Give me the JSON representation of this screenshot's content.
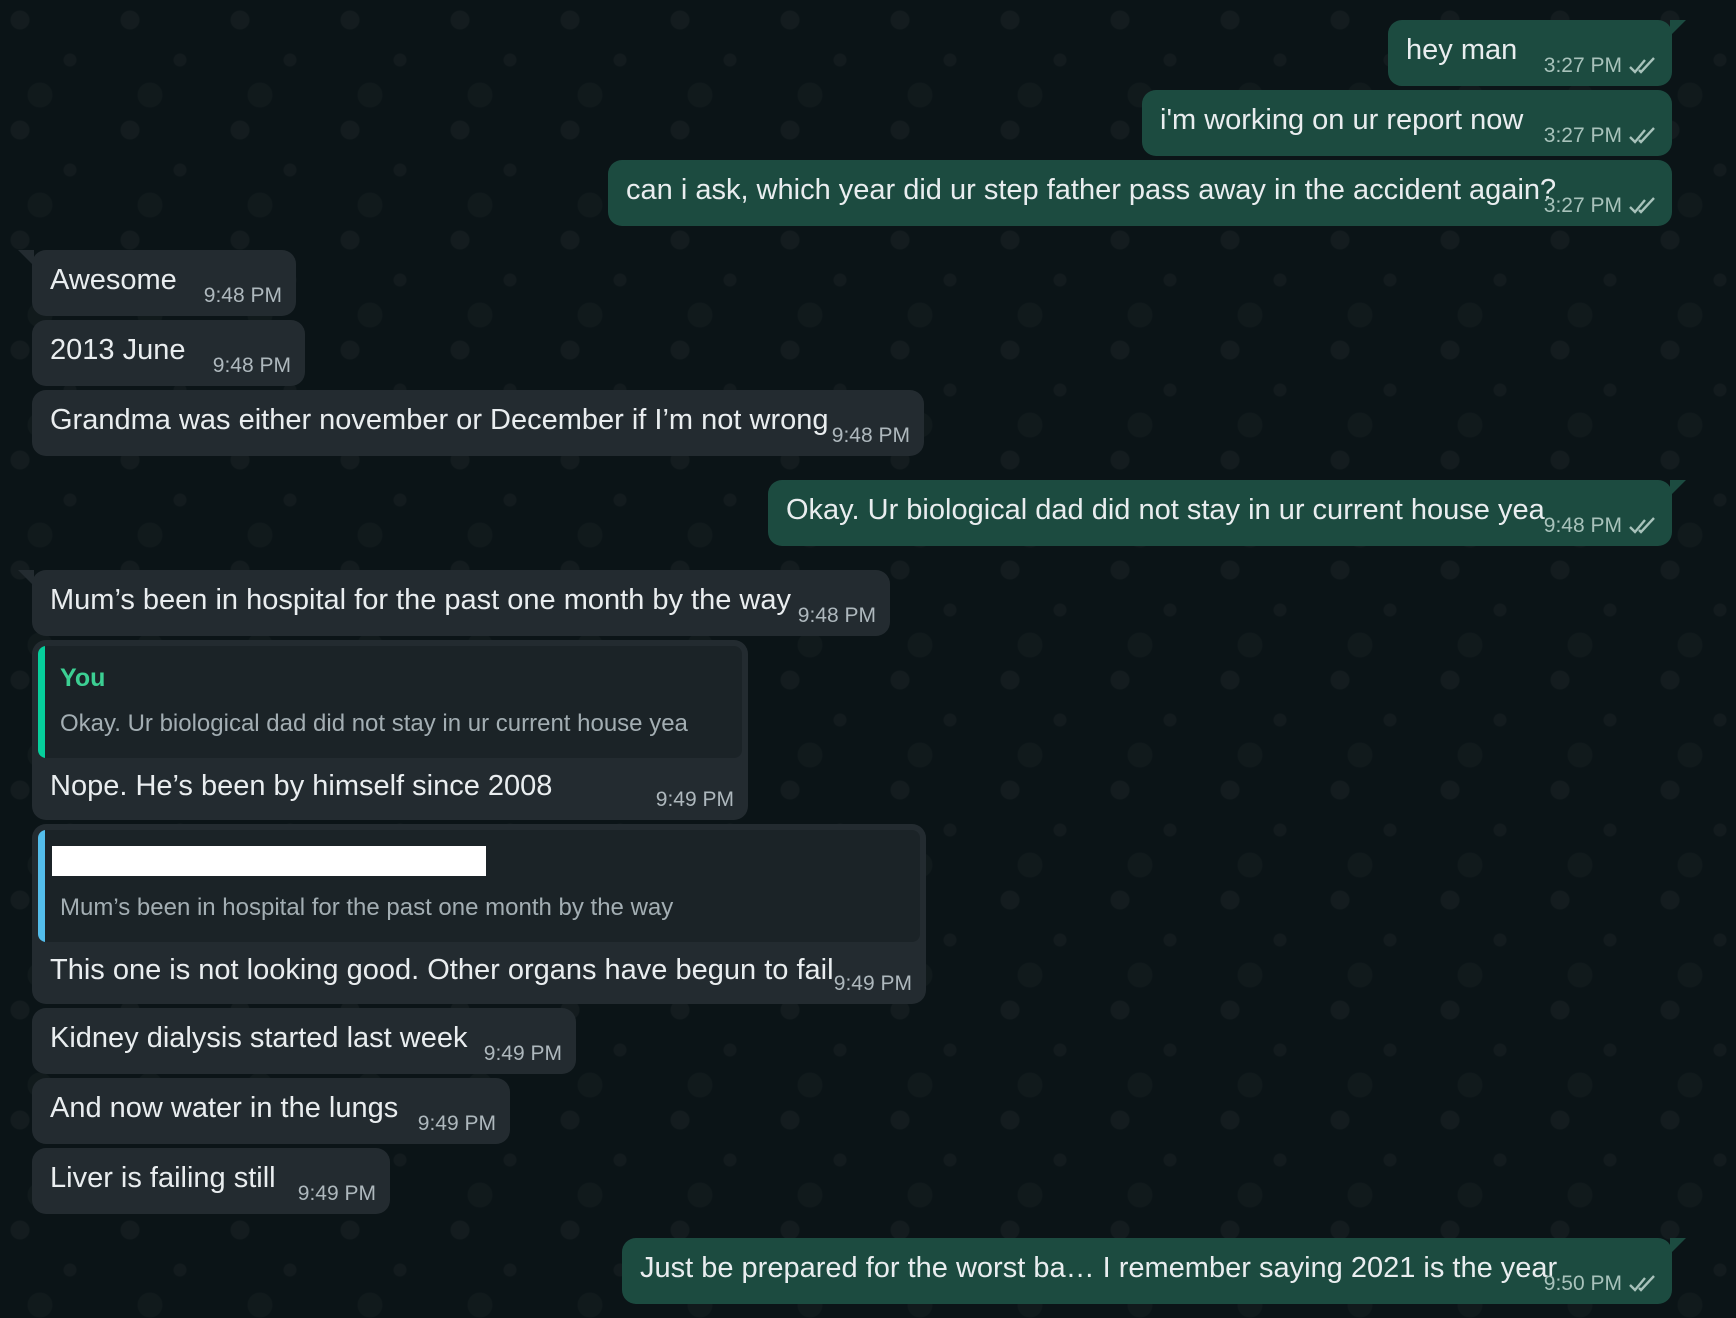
{
  "colors": {
    "outgoing_bubble": "#1c4b40",
    "incoming_bubble": "#232b30",
    "quote_you_bar": "#06cf9c",
    "quote_you_name": "#3ccf93",
    "quote_other_bar": "#53bdeb",
    "redaction": "#ffffff"
  },
  "messages": [
    {
      "direction": "out",
      "text": "hey man",
      "time": "3:27 PM",
      "status": "read"
    },
    {
      "direction": "out",
      "text": "i'm working on ur report now",
      "time": "3:27 PM",
      "status": "read"
    },
    {
      "direction": "out",
      "text": "can i ask, which year did ur step father pass away in the accident again?",
      "time": "3:27 PM",
      "status": "read"
    },
    {
      "direction": "in",
      "text": "Awesome",
      "time": "9:48 PM"
    },
    {
      "direction": "in",
      "text": "2013 June",
      "time": "9:48 PM"
    },
    {
      "direction": "in",
      "text": "Grandma was either november or December if I’m not wrong",
      "time": "9:48 PM"
    },
    {
      "direction": "out",
      "text": "Okay. Ur biological dad did not stay in ur current house yea",
      "time": "9:48 PM",
      "status": "read"
    },
    {
      "direction": "in",
      "text": "Mum’s been in hospital for the past one month by the way",
      "time": "9:48 PM"
    },
    {
      "direction": "in",
      "text": "Nope. He’s been by himself since 2008",
      "time": "9:49 PM",
      "quote": {
        "author": "You",
        "text": "Okay. Ur biological dad did not stay in ur current house yea"
      }
    },
    {
      "direction": "in",
      "text": "This one is not looking good. Other organs have begun to fail",
      "time": "9:49 PM",
      "quote": {
        "author": "",
        "author_redacted": true,
        "text": "Mum’s been in hospital for the past one month by the way"
      }
    },
    {
      "direction": "in",
      "text": "Kidney dialysis started last week",
      "time": "9:49 PM"
    },
    {
      "direction": "in",
      "text": "And now water in the lungs",
      "time": "9:49 PM"
    },
    {
      "direction": "in",
      "text": "Liver is failing still",
      "time": "9:49 PM"
    },
    {
      "direction": "out",
      "text": "Just be prepared for the worst ba… I remember saying 2021 is the year",
      "time": "9:50 PM",
      "status": "read"
    }
  ]
}
